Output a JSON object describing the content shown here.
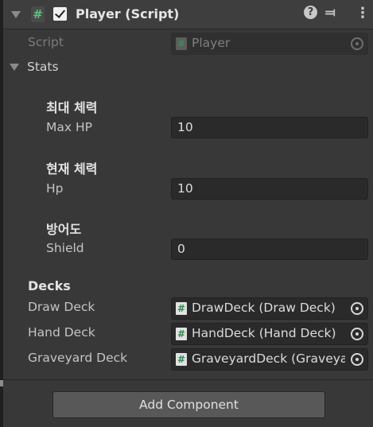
{
  "header": {
    "title": "Player (Script)",
    "enabled": true
  },
  "script_field": {
    "label": "Script",
    "value": "Player"
  },
  "stats": {
    "label": "Stats",
    "groups": [
      {
        "heading": "최대 체력",
        "label": "Max HP",
        "value": "10"
      },
      {
        "heading": "현재 체력",
        "label": "Hp",
        "value": "10"
      },
      {
        "heading": "방어도",
        "label": "Shield",
        "value": "0"
      }
    ]
  },
  "decks": {
    "heading": "Decks",
    "items": [
      {
        "label": "Draw Deck",
        "value": "DrawDeck (Draw Deck)"
      },
      {
        "label": "Hand Deck",
        "value": "HandDeck (Hand Deck)"
      },
      {
        "label": "Graveyard Deck",
        "value": "GraveyardDeck (Graveyard Deck)"
      }
    ]
  },
  "footer": {
    "add_component_label": "Add Component"
  },
  "icons": {
    "script": "script-hash-icon",
    "help": "help-icon",
    "presets": "presets-icon",
    "menu": "kebab-menu-icon"
  },
  "colors": {
    "hash_green": "#59c47c",
    "background": "#383838"
  }
}
